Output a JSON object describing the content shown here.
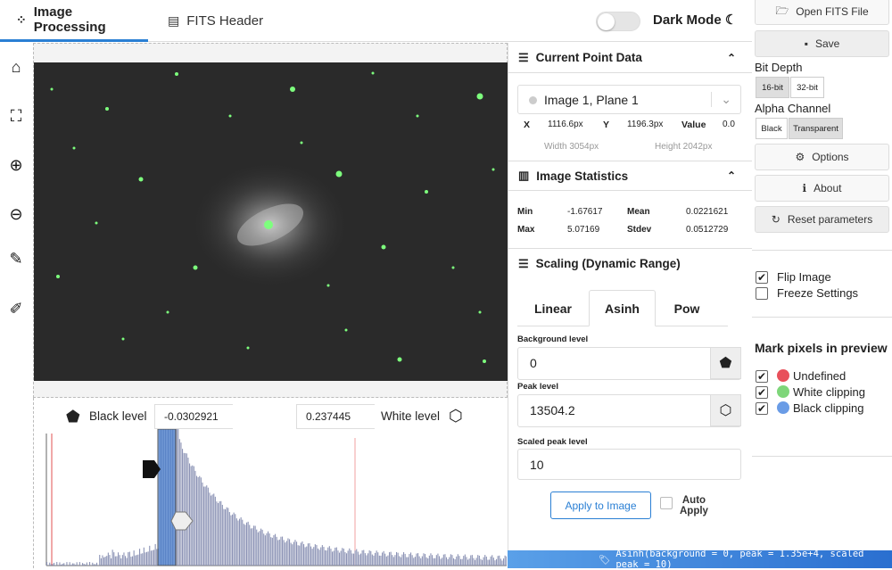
{
  "tabs": [
    {
      "label": "Image Processing",
      "icon": "spinner-icon"
    },
    {
      "label": "FITS Header",
      "icon": "list-icon"
    }
  ],
  "dark_mode": {
    "label": "Dark Mode",
    "icon": "moon-icon"
  },
  "levels": {
    "black_label": "Black level",
    "black_value": "-0.0302921",
    "white_value": "0.237445",
    "white_label": "White level"
  },
  "point_data": {
    "title": "Current Point Data",
    "image_select": "Image 1, Plane 1",
    "x_label": "X",
    "x_value": "1116.6px",
    "y_label": "Y",
    "y_value": "1196.3px",
    "value_label": "Value",
    "value": "0.0",
    "width": "Width 3054px",
    "height": "Height 2042px"
  },
  "stats": {
    "title": "Image Statistics",
    "min_label": "Min",
    "min": "-1.67617",
    "mean_label": "Mean",
    "mean": "0.0221621",
    "max_label": "Max",
    "max": "5.07169",
    "stdev_label": "Stdev",
    "stdev": "0.0512729"
  },
  "scaling": {
    "title": "Scaling (Dynamic Range)",
    "tabs": [
      "Linear",
      "Asinh",
      "Pow"
    ],
    "active_tab": "Asinh",
    "bg_label": "Background level",
    "bg_value": "0",
    "peak_label": "Peak level",
    "peak_value": "13504.2",
    "scaled_label": "Scaled peak level",
    "scaled_value": "10",
    "apply_label": "Apply to Image",
    "auto_apply_label": "Auto\nApply"
  },
  "side": {
    "open_label": "Open FITS File",
    "save_label": "Save",
    "bit_depth_label": "Bit Depth",
    "bit_16": "16-bit",
    "bit_32": "32-bit",
    "alpha_label": "Alpha Channel",
    "alpha_black": "Black",
    "alpha_transparent": "Transparent",
    "options_label": "Options",
    "about_label": "About",
    "reset_label": "Reset parameters",
    "flip_label": "Flip Image",
    "freeze_label": "Freeze Settings",
    "mark_title": "Mark pixels in preview",
    "undefined_label": "Undefined",
    "white_clip_label": "White clipping",
    "black_clip_label": "Black clipping"
  },
  "status": "Asinh(background = 0, peak = 1.35e+4, scaled peak = 10)",
  "colors": {
    "accent": "#2a7fd4",
    "undefined": "#e8505b",
    "white_clip": "#7ed67a",
    "black_clip": "#6a9ce6",
    "hist_bar": "#8c93b5",
    "star": "#7dff7d"
  }
}
